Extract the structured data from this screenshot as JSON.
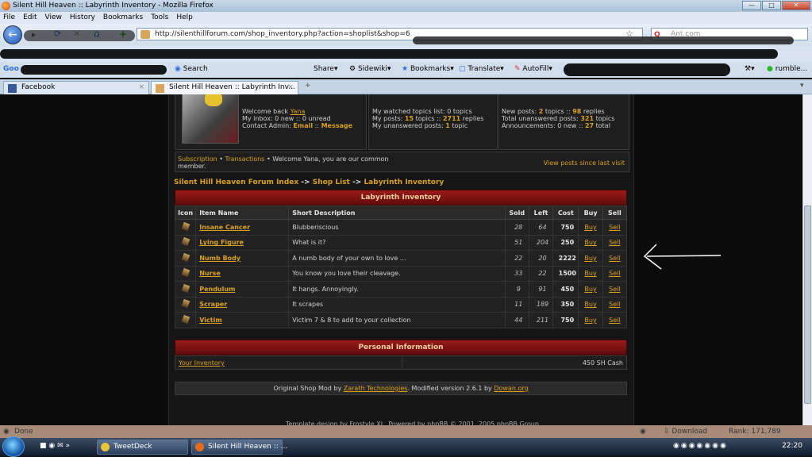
{
  "window": {
    "title": "Silent Hill Heaven :: Labyrinth Inventory - Mozilla Firefox",
    "minimize": "—",
    "maximize": "□",
    "close": "✕"
  },
  "menu": [
    "File",
    "Edit",
    "View",
    "History",
    "Bookmarks",
    "Tools",
    "Help"
  ],
  "url": "http://silenthillforum.com/shop_inventory.php?action=shoplist&shop=6",
  "search_placeholder": "Ant.com",
  "toolbar": {
    "search": "Search",
    "share": "Share",
    "sidewiki": "Sidewiki",
    "bookmarks": "Bookmarks",
    "translate": "Translate",
    "autofill": "AutoFill",
    "user": "rumble..."
  },
  "tabs": [
    {
      "label": "Facebook"
    },
    {
      "label": "Silent Hill Heaven :: Labyrinth Inv..."
    }
  ],
  "user_panel": {
    "welcome_prefix": "Welcome back",
    "username": "Yana",
    "inbox": "My inbox: 0 new :: 0 unread",
    "contact_prefix": "Contact Admin:",
    "contact_email": "Email",
    "contact_sep": "::",
    "contact_message": "Message"
  },
  "stats_mid": {
    "watched": "My watched topics list: 0 topics",
    "posts_prefix": "My posts:",
    "posts_topics": "15",
    "posts_topics_label": "topics ::",
    "posts_replies": "2711",
    "posts_replies_label": "replies",
    "unanswered_prefix": "My unanswered posts:",
    "unanswered_count": "1",
    "unanswered_label": "topic"
  },
  "stats_right": {
    "new_prefix": "New posts:",
    "new_topics": "2",
    "new_topics_label": "topics ::",
    "new_replies": "98",
    "new_replies_label": "replies",
    "total_prefix": "Total unanswered posts:",
    "total_count": "321",
    "total_label": "topics",
    "announce_prefix": "Announcements: 0 new ::",
    "announce_total": "27",
    "announce_label": "total"
  },
  "subbar": {
    "subscription": "Subscription",
    "sep1": "•",
    "transactions": "Transactions",
    "message": "• Welcome Yana, you are our common member.",
    "view_since": "View posts since last visit"
  },
  "breadcrumb": {
    "index": "Silent Hill Heaven Forum Index",
    "arrow": "->",
    "shop_list": "Shop List",
    "current": "Labyrinth Inventory"
  },
  "inventory": {
    "title": "Labyrinth Inventory",
    "columns": [
      "Icon",
      "Item Name",
      "Short Description",
      "Sold",
      "Left",
      "Cost",
      "Buy",
      "Sell"
    ],
    "buy_label": "Buy",
    "sell_label": "Sell",
    "rows": [
      {
        "name": "Insane Cancer",
        "desc": "Blubberiscious",
        "sold": "28",
        "left": "64",
        "cost": "750"
      },
      {
        "name": "Lying Figure",
        "desc": "What is it?",
        "sold": "51",
        "left": "204",
        "cost": "250"
      },
      {
        "name": "Numb Body",
        "desc": "A numb body of your own to love ...",
        "sold": "22",
        "left": "20",
        "cost": "2222"
      },
      {
        "name": "Nurse",
        "desc": "You know you love their cleavage.",
        "sold": "33",
        "left": "22",
        "cost": "1500"
      },
      {
        "name": "Pendulum",
        "desc": "It hangs. Annoyingly.",
        "sold": "9",
        "left": "91",
        "cost": "450"
      },
      {
        "name": "Scraper",
        "desc": "It scrapes",
        "sold": "11",
        "left": "189",
        "cost": "350"
      },
      {
        "name": "Victim",
        "desc": "Victim 7 & 8 to add to your collection",
        "sold": "44",
        "left": "211",
        "cost": "750"
      }
    ]
  },
  "personal": {
    "title": "Personal Information",
    "inventory_link": "Your Inventory",
    "cash": "450 SH Cash"
  },
  "footer": {
    "prefix": "Original Shop Mod by",
    "author": "Zarath Technologies",
    "mid": ". Modified version 2.6.1 by",
    "modder": "Dowan.org"
  },
  "template_credit": "Template design by Frostyle XL. Powered by phpBB © 2001, 2005 phpBB Group",
  "status": {
    "text": "Done",
    "download": "Download",
    "rank": "Rank: 171,789"
  },
  "taskbar": {
    "items": [
      {
        "label": "TweetDeck"
      },
      {
        "label": "Silent Hill Heaven :: ..."
      }
    ],
    "clock": "22:20"
  },
  "colors": {
    "accent_gold": "#d9a21c",
    "header_red": "#9c1b1b",
    "page_bg": "#0b0b0c"
  }
}
